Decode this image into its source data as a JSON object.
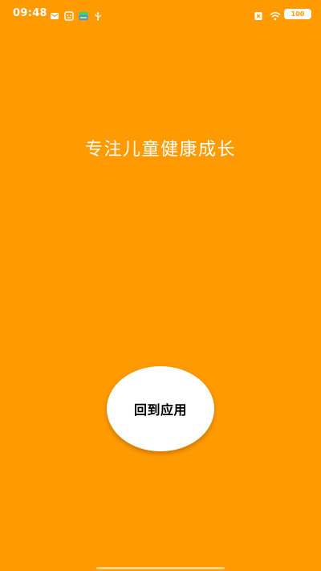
{
  "status_bar": {
    "time": "09:48",
    "left_icons": [
      "mail-icon",
      "robot-icon",
      "app-icon",
      "usb-icon"
    ],
    "right_icons": [
      "sim-off-icon",
      "wifi-icon"
    ],
    "battery": "100"
  },
  "main": {
    "slogan": "专注儿童健康成长",
    "return_button_label": "回到应用"
  },
  "colors": {
    "background": "#FF9A00",
    "button_background": "#FFFFFF",
    "text_light": "#FFFFFF",
    "text_dark": "#000000"
  }
}
